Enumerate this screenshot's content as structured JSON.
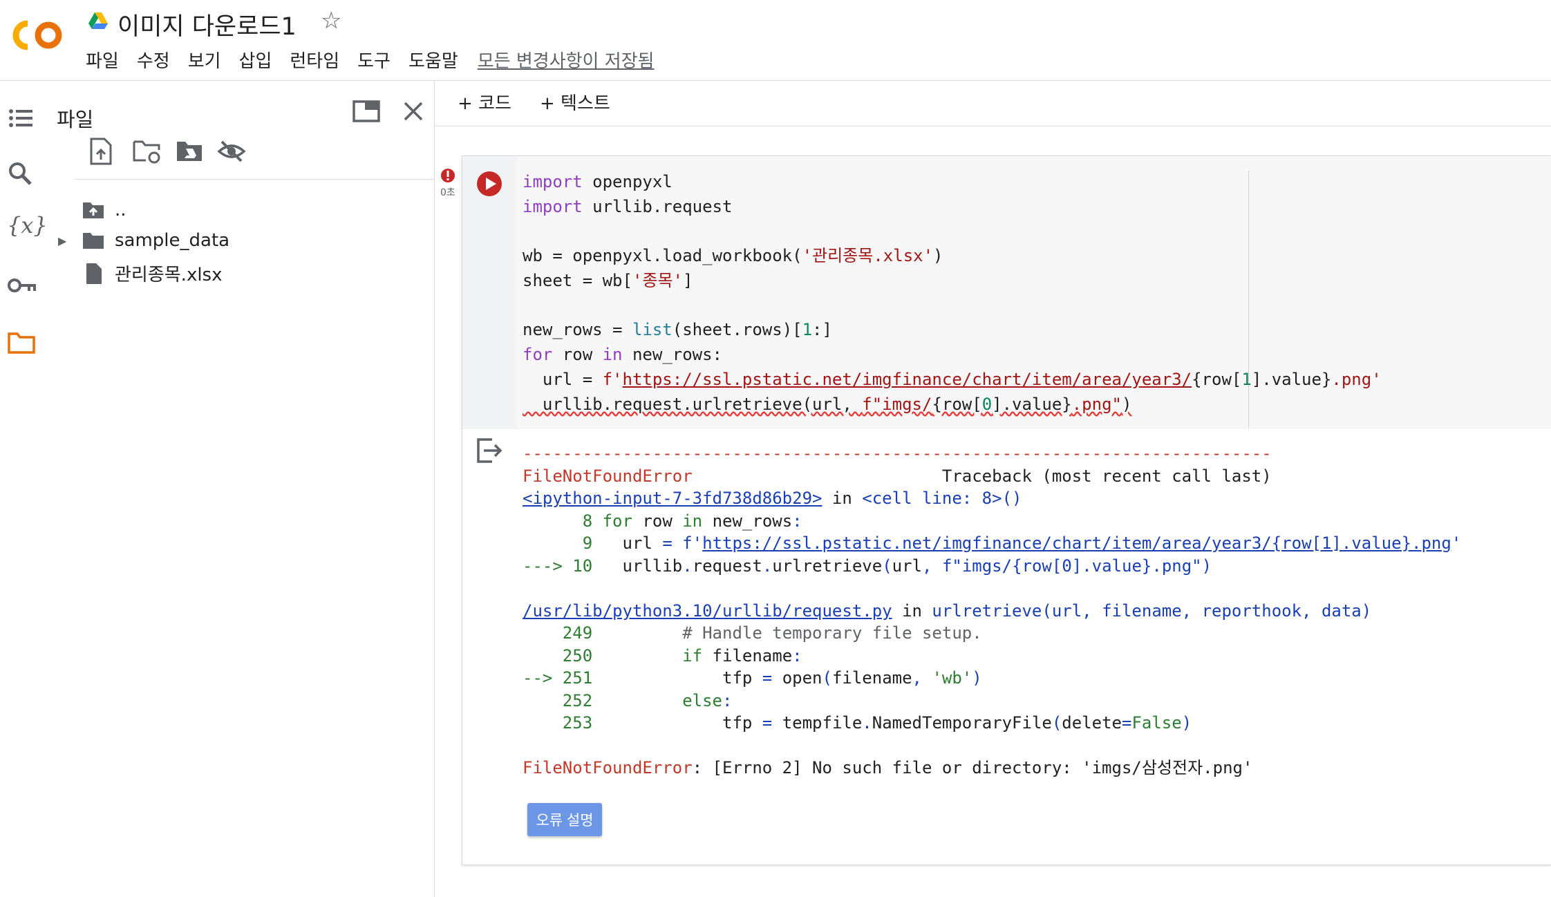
{
  "header": {
    "logo": "colab-logo",
    "title": "이미지 다운로드1",
    "menu": [
      "파일",
      "수정",
      "보기",
      "삽입",
      "런타임",
      "도구",
      "도움말"
    ],
    "saved_status": "모든 변경사항이 저장됨"
  },
  "files_panel": {
    "title": "파일",
    "tree": [
      {
        "label": "..",
        "icon": "folder-up-icon"
      },
      {
        "label": "sample_data",
        "icon": "folder-icon"
      },
      {
        "label": "관리종목.xlsx",
        "icon": "file-icon"
      }
    ]
  },
  "notebook": {
    "add_code": "+ 코드",
    "add_text": "+ 텍스트",
    "exec_time": "0초",
    "explain_button": "오류 설명"
  }
}
